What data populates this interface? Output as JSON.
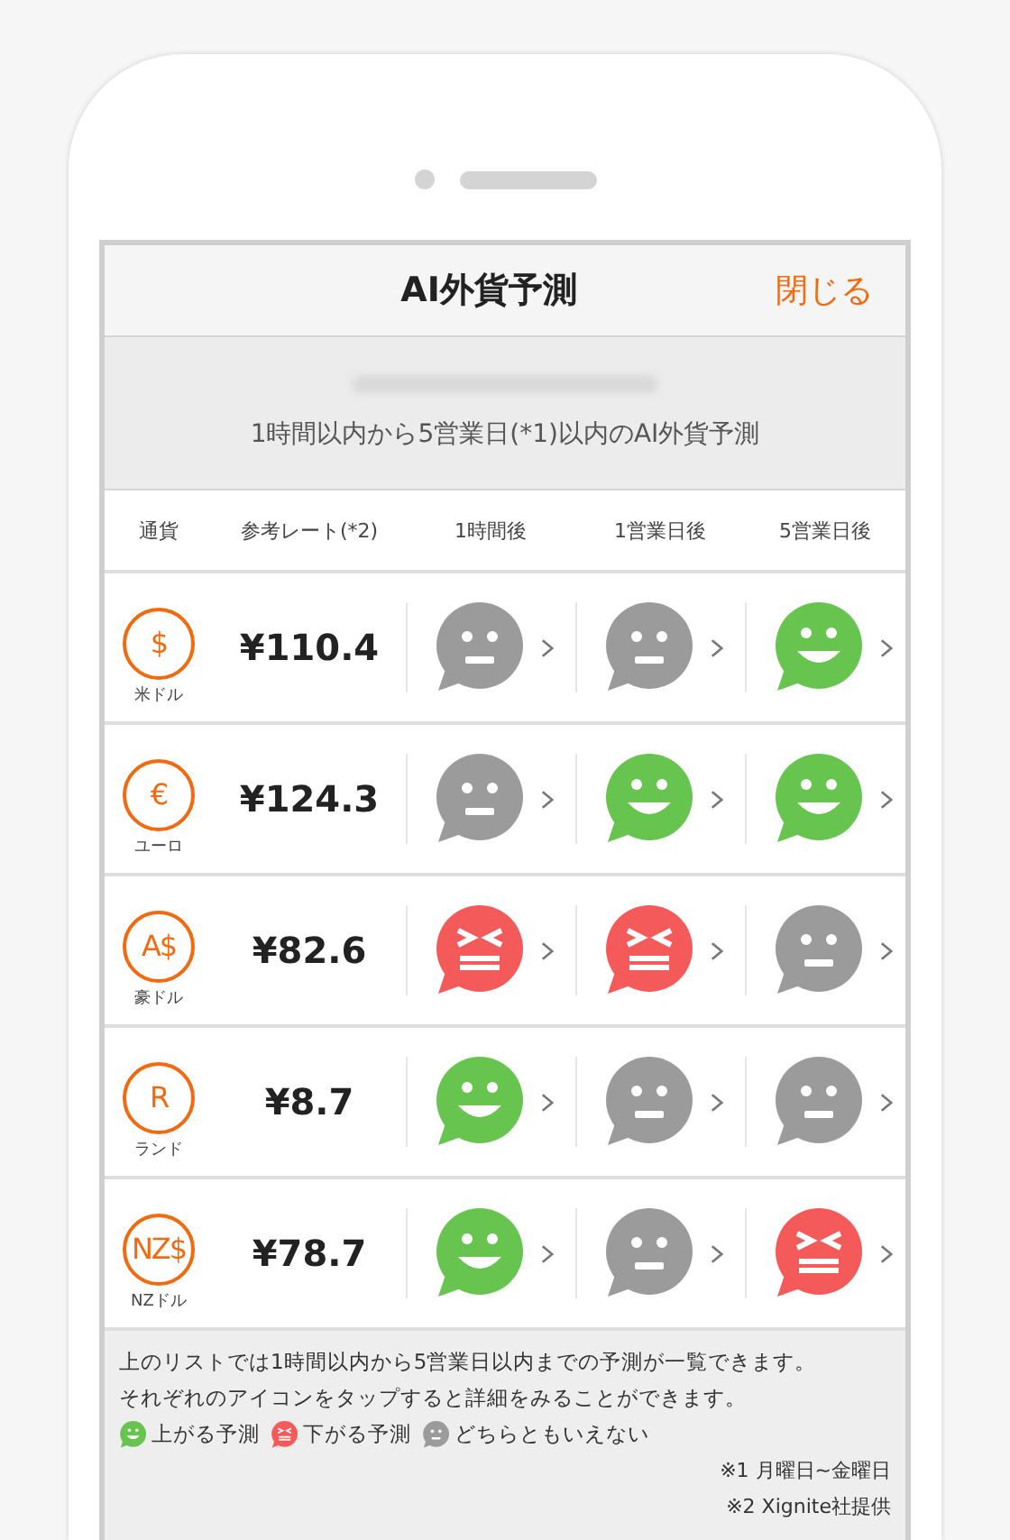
{
  "header": {
    "title": "AI外貨予測",
    "close": "閉じる"
  },
  "info": {
    "timestamp_blurred": true,
    "subtitle": "1時間以内から5営業日(*1)以内のAI外貨予測"
  },
  "columns": [
    "通貨",
    "参考レート(*2)",
    "1時間後",
    "1営業日後",
    "5営業日後"
  ],
  "rows": [
    {
      "symbol": "$",
      "currency": "米ドル",
      "rate": "¥110.4",
      "forecasts": [
        {
          "kind": "neutral"
        },
        {
          "kind": "neutral"
        },
        {
          "kind": "up"
        }
      ]
    },
    {
      "symbol": "€",
      "currency": "ユーロ",
      "rate": "¥124.3",
      "forecasts": [
        {
          "kind": "neutral"
        },
        {
          "kind": "up"
        },
        {
          "kind": "up"
        }
      ]
    },
    {
      "symbol": "A$",
      "currency": "豪ドル",
      "rate": "¥82.6",
      "forecasts": [
        {
          "kind": "down"
        },
        {
          "kind": "down"
        },
        {
          "kind": "neutral"
        }
      ]
    },
    {
      "symbol": "R",
      "currency": "ランド",
      "rate": "¥8.7",
      "forecasts": [
        {
          "kind": "up"
        },
        {
          "kind": "neutral"
        },
        {
          "kind": "neutral"
        }
      ]
    },
    {
      "symbol": "NZ$",
      "currency": "NZドル",
      "rate": "¥78.7",
      "forecasts": [
        {
          "kind": "up"
        },
        {
          "kind": "neutral"
        },
        {
          "kind": "down"
        }
      ]
    }
  ],
  "notes": [
    "上のリストでは1時間以内から5営業日以内までの予測が一覧できます。",
    "それぞれのアイコンをタップすると詳細をみることができます。"
  ],
  "legend": [
    {
      "kind": "up",
      "label": "上がる予測"
    },
    {
      "kind": "down",
      "label": "下がる予測"
    },
    {
      "kind": "neutral",
      "label": "どちらともいえない"
    }
  ],
  "footnotes": [
    "※1 月曜日~金曜日",
    "※2 Xignite社提供"
  ]
}
